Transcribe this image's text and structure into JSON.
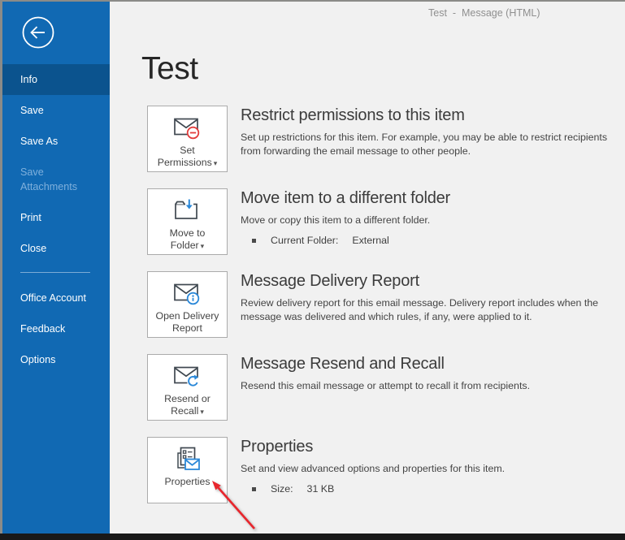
{
  "window": {
    "title": "Test  -  Message (HTML)"
  },
  "colors": {
    "sidebar": "#1169b3",
    "sidebar_selected": "#0b538e",
    "accent_blue": "#2b88d8",
    "icon_dark": "#3f4850",
    "red_badge": "#e23c3c",
    "arrow_red": "#e8262d",
    "content_bg": "#f1f1f1",
    "button_border": "#ababab",
    "heading_text": "#3b3b3b",
    "body_text": "#444444",
    "titlebar_text": "#8f8f8f"
  },
  "icons": {
    "dropdown_caret": "▾"
  },
  "backstage": {
    "nav": [
      {
        "label": "Info",
        "selected": true
      },
      {
        "label": "Save"
      },
      {
        "label": "Save As"
      },
      {
        "label": "Save Attachments",
        "disabled": true
      },
      {
        "label": "Print"
      },
      {
        "label": "Close"
      },
      {
        "divider": true
      },
      {
        "label": "Office Account"
      },
      {
        "label": "Feedback"
      },
      {
        "label": "Options"
      }
    ]
  },
  "page": {
    "title": "Test",
    "sections": [
      {
        "button": {
          "label": "Set Permissions",
          "icon": "mail-restrict-icon",
          "has_dropdown": true
        },
        "heading": "Restrict permissions to this item",
        "description": "Set up restrictions for this item. For example, you may be able to restrict recipients from forwarding the email message to other people.",
        "bullets": []
      },
      {
        "button": {
          "label": "Move to Folder",
          "icon": "folder-move-icon",
          "has_dropdown": true
        },
        "heading": "Move item to a different folder",
        "description": "Move or copy this item to a different folder.",
        "bullets": [
          {
            "label": "Current Folder:",
            "value": "External"
          }
        ]
      },
      {
        "button": {
          "label": "Open Delivery Report",
          "icon": "mail-info-icon",
          "has_dropdown": false
        },
        "heading": "Message Delivery Report",
        "description": "Review delivery report for this email message. Delivery report includes when the message was delivered and which rules, if any, were applied to it.",
        "bullets": []
      },
      {
        "button": {
          "label": "Resend or Recall",
          "icon": "mail-recall-icon",
          "has_dropdown": true
        },
        "heading": "Message Resend and Recall",
        "description": "Resend this email message or attempt to recall it from recipients.",
        "bullets": []
      },
      {
        "button": {
          "label": "Properties",
          "icon": "properties-icon",
          "has_dropdown": false
        },
        "heading": "Properties",
        "description": "Set and view advanced options and properties for this item.",
        "bullets": [
          {
            "label": "Size:",
            "value": "31 KB"
          }
        ]
      }
    ]
  }
}
